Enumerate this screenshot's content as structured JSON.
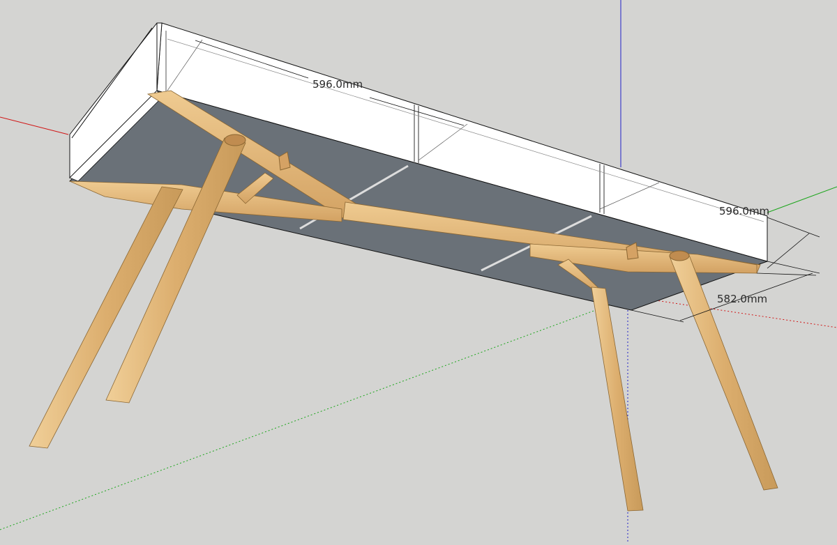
{
  "viewport": {
    "background": "#d4d4d2",
    "axes": {
      "red": "#d11515",
      "green": "#1aa51a",
      "blue": "#2020c8"
    }
  },
  "model": {
    "carcass_color": "#ffffff",
    "panel_color": "#6a7178",
    "wood_color": "#e3b77c",
    "wood_dark": "#b88a4e"
  },
  "dimensions": {
    "top_width": "596.0mm",
    "side_depth": "596.0mm",
    "lower_depth": "582.0mm"
  }
}
